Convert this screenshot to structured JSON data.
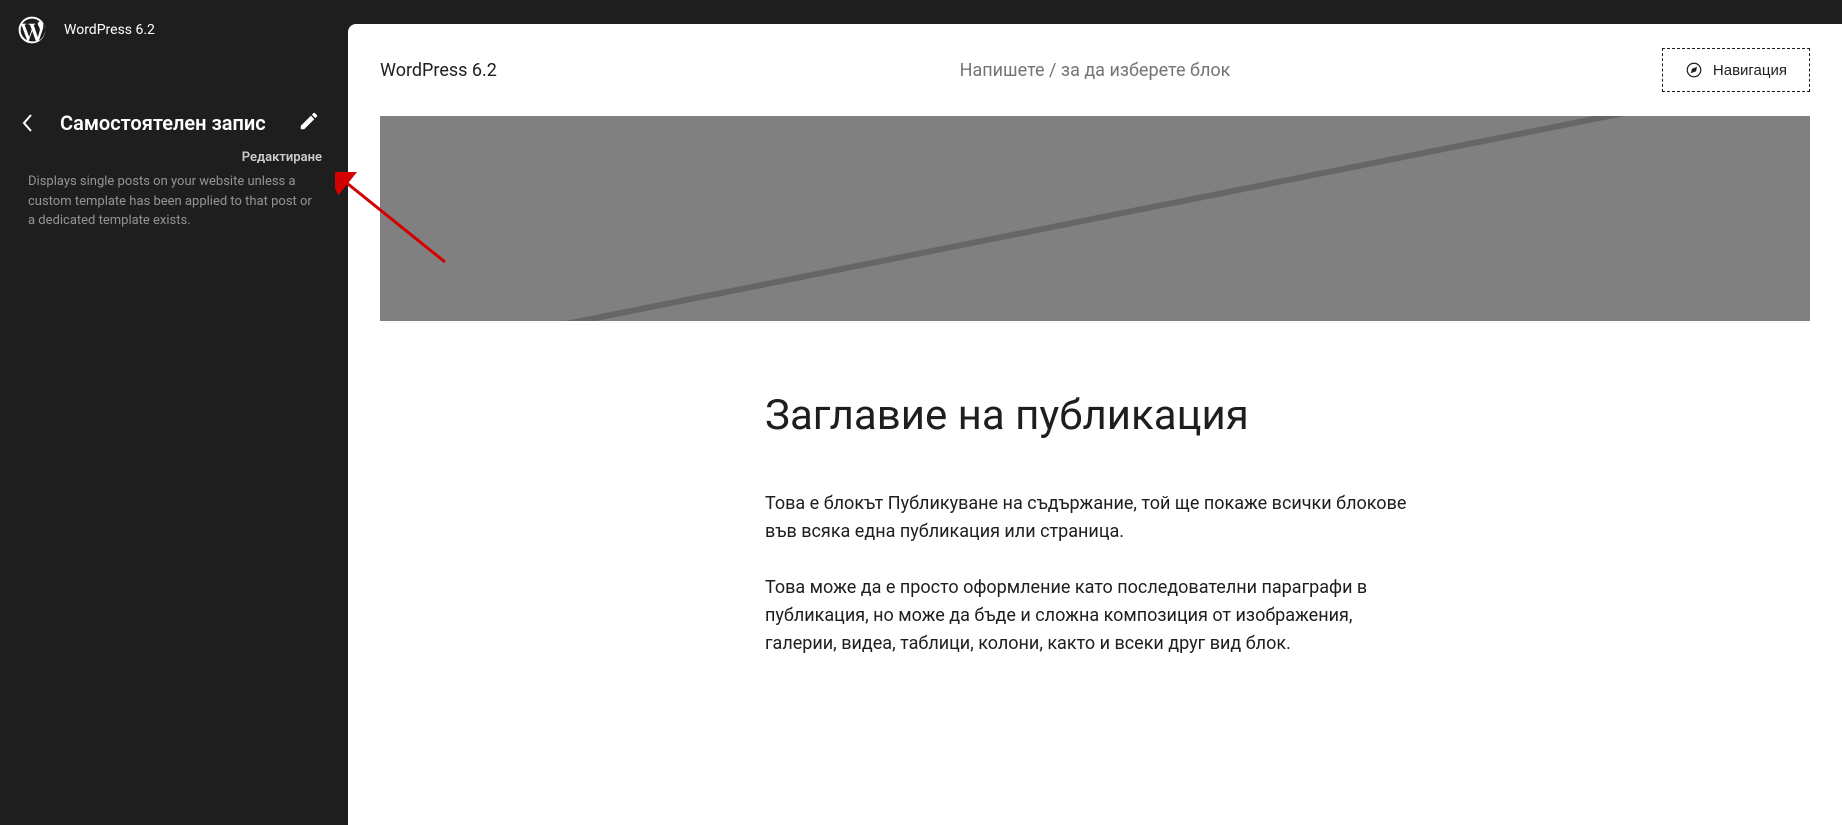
{
  "top": {
    "site_name": "WordPress 6.2"
  },
  "sidebar": {
    "title": "Самостоятелен запис",
    "edit_tooltip": "Редактиране",
    "description": "Displays single posts on your website unless a custom template has been applied to that post or a dedicated template exists."
  },
  "editor": {
    "site_title": "WordPress 6.2",
    "prompt": "Напишете / за да изберете блок",
    "nav_button": "Навигация",
    "post_title": "Заглавие на публикация",
    "paragraph1": "Това е блокът Публикуване на съдържание, той ще покаже всички блокове във всяка една публикация или страница.",
    "paragraph2": "Това може да е просто оформление като последователни параграфи в публикация, но може да бъде и сложна композиция от изображения, галерии, видеа, таблици, колони, както и всеки друг вид блок."
  }
}
